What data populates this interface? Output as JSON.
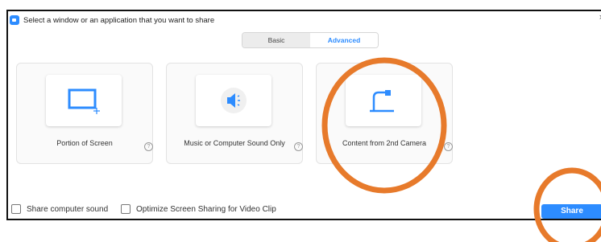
{
  "window": {
    "title": "Select a window or an application that you want to share",
    "close_glyph": "×"
  },
  "tabs": [
    {
      "label": "Basic",
      "selected": false
    },
    {
      "label": "Advanced",
      "selected": true
    }
  ],
  "cards": [
    {
      "label": "Portion of Screen",
      "icon": "portion-screen-icon"
    },
    {
      "label": "Music or Computer Sound Only",
      "icon": "speaker-icon"
    },
    {
      "label": "Content from 2nd Camera",
      "icon": "camera-icon"
    }
  ],
  "help_glyph": "?",
  "footer": {
    "share_sound_label": "Share computer sound",
    "optimize_label": "Optimize Screen Sharing for Video Clip",
    "share_button_label": "Share"
  },
  "colors": {
    "accent": "#2d8cff",
    "annotation": "#e77a2b"
  }
}
